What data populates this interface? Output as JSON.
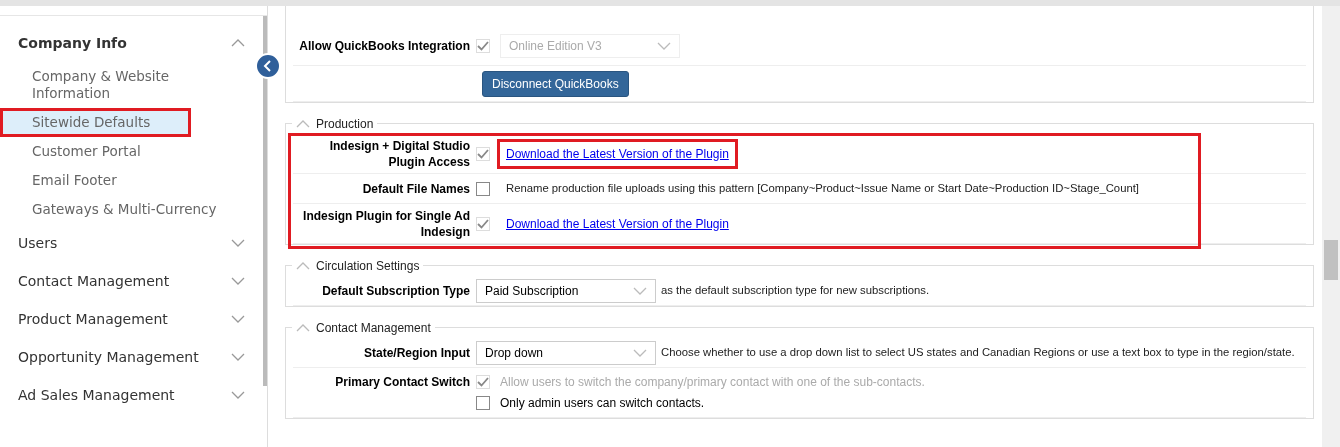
{
  "sidebar": {
    "groups": [
      {
        "label": "Company Info",
        "expanded": true,
        "children": [
          {
            "label": "Company & Website Information",
            "selected": false,
            "highlighted": false
          },
          {
            "label": "Sitewide Defaults",
            "selected": true,
            "highlighted": true
          },
          {
            "label": "Customer Portal",
            "selected": false,
            "highlighted": false
          },
          {
            "label": "Email Footer",
            "selected": false,
            "highlighted": false
          },
          {
            "label": "Gateways & Multi-Currency",
            "selected": false,
            "highlighted": false
          }
        ]
      },
      {
        "label": "Users",
        "expanded": false
      },
      {
        "label": "Contact Management",
        "expanded": false
      },
      {
        "label": "Product Management",
        "expanded": false
      },
      {
        "label": "Opportunity Management",
        "expanded": false
      },
      {
        "label": "Ad Sales Management",
        "expanded": false
      }
    ]
  },
  "sections": [
    {
      "highlighted": false,
      "rows": [
        {
          "label": "Allow QuickBooks Integration",
          "checkbox": {
            "checked": true,
            "disabled": true
          },
          "select": {
            "value": "Online Edition V3",
            "disabled": true
          }
        },
        {
          "button": "Disconnect QuickBooks"
        }
      ]
    },
    {
      "legend": "Production",
      "expanded": true,
      "highlighted": true,
      "rows": [
        {
          "label": "Indesign + Digital Studio Plugin Access",
          "checkbox": {
            "checked": true,
            "disabled": true
          },
          "link": {
            "text": "Download the Latest Version of the Plugin",
            "highlighted": true
          }
        },
        {
          "label": "Default File Names",
          "checkbox": {
            "checked": false,
            "disabled": false
          },
          "text": "Rename production file uploads using this pattern [Company~Product~Issue Name or Start Date~Production ID~Stage_Count]"
        },
        {
          "label": "Indesign Plugin for Single Ad Indesign",
          "checkbox": {
            "checked": true,
            "disabled": true
          },
          "link": {
            "text": "Download the Latest Version of the Plugin",
            "highlighted": false
          }
        }
      ]
    },
    {
      "legend": "Circulation Settings",
      "expanded": true,
      "highlighted": false,
      "rows": [
        {
          "label": "Default Subscription Type",
          "select": {
            "value": "Paid Subscription",
            "disabled": false
          },
          "text": "as the default subscription type for new subscriptions."
        }
      ]
    },
    {
      "legend": "Contact Management",
      "expanded": true,
      "highlighted": false,
      "rows": [
        {
          "label": "State/Region Input",
          "select": {
            "value": "Drop down",
            "disabled": false
          },
          "text": "Choose whether to use a drop down list to select US states and Canadian Regions or use a text box to type in the region/state."
        },
        {
          "label": "Primary Contact Switch",
          "options": [
            {
              "label": "Allow users to switch the company/primary contact with one of the sub-contacts.",
              "checked": true,
              "disabled": true
            },
            {
              "label": "Only admin users can switch contacts.",
              "checked": false,
              "disabled": false
            }
          ]
        }
      ]
    }
  ]
}
